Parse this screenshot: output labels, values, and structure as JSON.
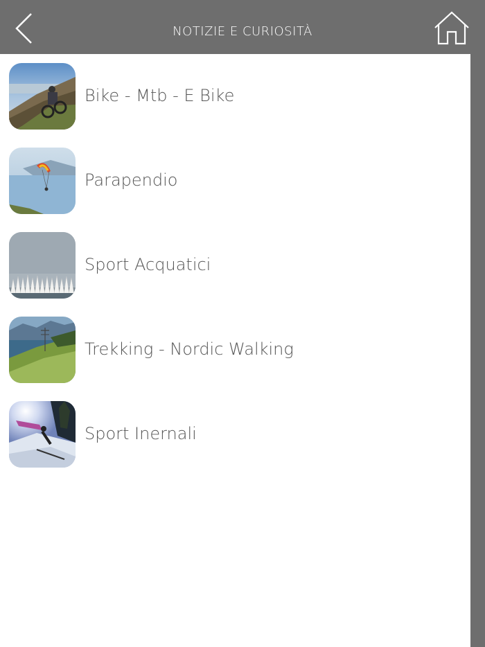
{
  "header": {
    "title": "NOTIZIE E CURIOSITÀ",
    "back_icon": "chevron-left-icon",
    "home_icon": "home-icon",
    "background_color": "#6e6e6e",
    "text_color": "#ffffff"
  },
  "list": {
    "items": [
      {
        "label": "Bike - Mtb - E Bike",
        "thumbnail": "mountain-bike-photo"
      },
      {
        "label": "Parapendio",
        "thumbnail": "paragliding-photo"
      },
      {
        "label": "Sport Acquatici",
        "thumbnail": "sailing-regatta-photo"
      },
      {
        "label": "Trekking - Nordic Walking",
        "thumbnail": "mountain-trekking-photo"
      },
      {
        "label": "Sport Inernali",
        "thumbnail": "skiing-photo"
      }
    ]
  },
  "colors": {
    "list_background": "#ffffff",
    "label_color": "#555555",
    "scrollbar": "#6e6e6e"
  }
}
